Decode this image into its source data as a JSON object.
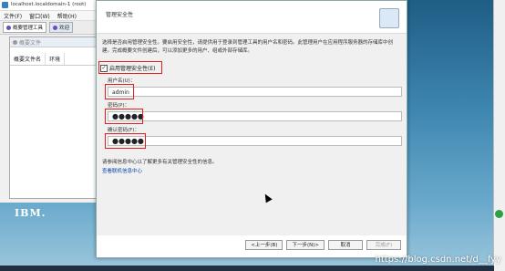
{
  "background_window": {
    "title": "localhost.localdomain-1 (root)",
    "menu": [
      "文件(F)",
      "窗口(W)",
      "帮助(H)"
    ],
    "tabs": [
      "概要管理工具",
      "欢迎"
    ],
    "panel_title": "概要文件",
    "table_headers": [
      "概要文件名",
      "环境"
    ]
  },
  "brand": "IBM.",
  "dialog": {
    "title": "管理安全性",
    "description": "选择是否启用管理安全性。要启用安全性，请提供用于登录到管理工具的用户名和密码。此管理用户在应用程序服务器的存储库中创建。完成概要文件创建后，可以添加更多的用户、组或外部存储库。",
    "enable_security_label": "启用管理安全性(E)",
    "enable_security_checked": true,
    "username_label": "用户名(U)：",
    "username_value": "admin",
    "password_label": "密码(P)：",
    "password_value": "●●●●●",
    "confirm_label": "确认密码(F)：",
    "confirm_value": "●●●●●",
    "info_text": "请参阅信息中心以了解更多有关管理安全性的信息。",
    "info_link": "查看联机信息中心",
    "buttons": {
      "back": "<上一步(B)",
      "next": "下一步(N)>",
      "cancel": "取消",
      "finish": "完成(F)"
    }
  },
  "watermark": "https://blog.csdn.net/d__fyy",
  "colors": {
    "highlight": "#e1201c",
    "link": "#0645ad"
  }
}
